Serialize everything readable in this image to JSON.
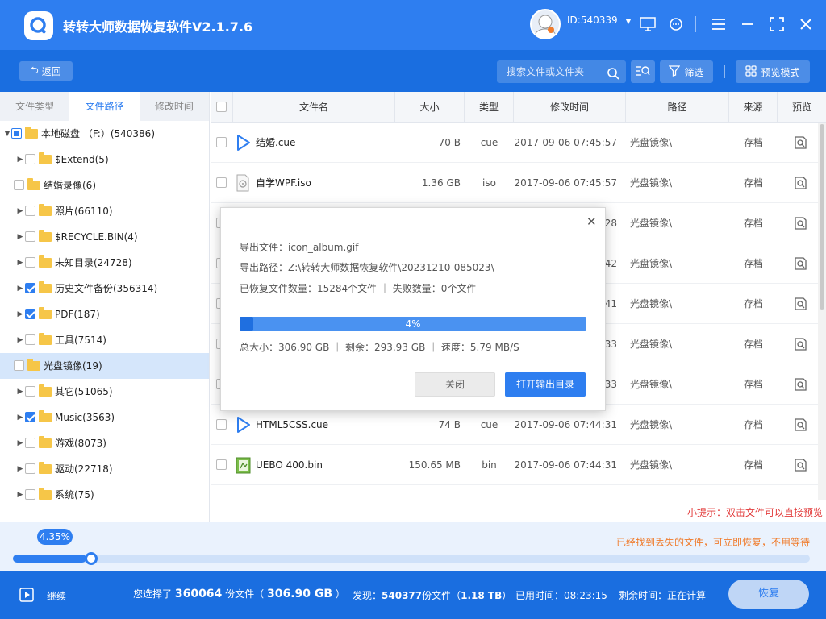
{
  "app": {
    "title": "转转大师数据恢复软件V2.1.7.6",
    "user_id": "ID:540339"
  },
  "colors": {
    "primary": "#2e7ef0",
    "toolbar": "#1a6ee0",
    "tip_red": "#e23b3b",
    "tip_orange": "#f07c2c"
  },
  "toolbar": {
    "back_label": "返回",
    "search_placeholder": "搜索文件或文件夹",
    "filter_label": "筛选",
    "preview_mode_label": "预览模式"
  },
  "left_tabs": [
    "文件类型",
    "文件路径",
    "修改时间"
  ],
  "tree": [
    {
      "label": "本地磁盘  （F:）(540386)",
      "expanded": true,
      "level": 0,
      "check": "partial"
    },
    {
      "label": "$Extend(5)",
      "level": 1,
      "check": "none",
      "arrow": true
    },
    {
      "label": "结婚录像(6)",
      "level": 1,
      "check": "none",
      "arrow": false
    },
    {
      "label": "照片(66110)",
      "level": 1,
      "check": "none",
      "arrow": true
    },
    {
      "label": "$RECYCLE.BIN(4)",
      "level": 1,
      "check": "none",
      "arrow": true
    },
    {
      "label": "未知目录(24728)",
      "level": 1,
      "check": "none",
      "arrow": true
    },
    {
      "label": "历史文件备份(356314)",
      "level": 1,
      "check": "checked",
      "arrow": true
    },
    {
      "label": "PDF(187)",
      "level": 1,
      "check": "checked",
      "arrow": true
    },
    {
      "label": "工具(7514)",
      "level": 1,
      "check": "none",
      "arrow": true
    },
    {
      "label": "光盘镜像(19)",
      "level": 1,
      "check": "none",
      "arrow": false,
      "selected": true
    },
    {
      "label": "其它(51065)",
      "level": 1,
      "check": "none",
      "arrow": true
    },
    {
      "label": "Music(3563)",
      "level": 1,
      "check": "checked",
      "arrow": true
    },
    {
      "label": "游戏(8073)",
      "level": 1,
      "check": "none",
      "arrow": true
    },
    {
      "label": "驱动(22718)",
      "level": 1,
      "check": "none",
      "arrow": true
    },
    {
      "label": "系统(75)",
      "level": 1,
      "check": "none",
      "arrow": true
    }
  ],
  "table": {
    "headers": [
      "文件名",
      "大小",
      "类型",
      "修改时间",
      "路径",
      "来源",
      "预览"
    ],
    "rows": [
      {
        "name": "结婚.cue",
        "size": "70 B",
        "type": "cue",
        "time": "2017-09-06 07:45:57",
        "path": "光盘镜像\\",
        "source": "存档",
        "icon": "play-icon"
      },
      {
        "name": "自学WPF.iso",
        "size": "1.36 GB",
        "type": "iso",
        "time": "2017-09-06 07:45:57",
        "path": "光盘镜像\\",
        "source": "存档",
        "icon": "disc-icon"
      },
      {
        "name": "",
        "size": "",
        "type": "",
        "time": "28",
        "path": "光盘镜像\\",
        "source": "存档",
        "icon": ""
      },
      {
        "name": "",
        "size": "",
        "type": "",
        "time": "42",
        "path": "光盘镜像\\",
        "source": "存档",
        "icon": ""
      },
      {
        "name": "",
        "size": "",
        "type": "",
        "time": "41",
        "path": "光盘镜像\\",
        "source": "存档",
        "icon": ""
      },
      {
        "name": "",
        "size": "",
        "type": "",
        "time": "33",
        "path": "光盘镜像\\",
        "source": "存档",
        "icon": ""
      },
      {
        "name": "",
        "size": "",
        "type": "",
        "time": "33",
        "path": "光盘镜像\\",
        "source": "存档",
        "icon": ""
      },
      {
        "name": "HTML5CSS.cue",
        "size": "74 B",
        "type": "cue",
        "time": "2017-09-06 07:44:31",
        "path": "光盘镜像\\",
        "source": "存档",
        "icon": "play-icon"
      },
      {
        "name": "UEBO 400.bin",
        "size": "150.65 MB",
        "type": "bin",
        "time": "2017-09-06 07:44:31",
        "path": "光盘镜像\\",
        "source": "存档",
        "icon": "bin-file-icon"
      }
    ]
  },
  "tip": "小提示：双击文件可以直接预览",
  "scan": {
    "found_tip": "已经找到丢失的文件，可立即恢复，不用等待",
    "percent_label": "4.35%",
    "percent": 4.35
  },
  "status": {
    "continue_label": "继续",
    "selected_prefix": "您选择了",
    "selected_count": "360064",
    "selected_unit": "份文件（",
    "selected_size": "306.90 GB",
    "selected_suffix": "）",
    "found_prefix": "发现：",
    "found_count": "540377",
    "found_unit": "份文件（",
    "found_size": "1.18 TB",
    "found_suffix": "）",
    "elapsed": "已用时间：08:23:15",
    "remaining": "剩余时间：正在计算",
    "recover_label": "恢复"
  },
  "modal": {
    "export_file": "导出文件：icon_album.gif",
    "export_path": "导出路径：Z:\\转转大师数据恢复软件\\20231210-085023\\",
    "recovered": "已恢复文件数量：15284个文件 ｜ 失败数量：0个文件",
    "progress_label": "4%",
    "progress": 4,
    "stats": "总大小：306.90 GB ｜ 剩余：293.93 GB ｜ 速度：5.79 MB/S",
    "close_label": "关闭",
    "open_dir_label": "打开输出目录"
  }
}
